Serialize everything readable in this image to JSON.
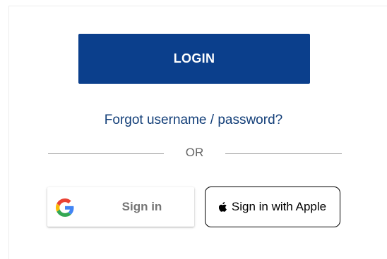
{
  "login": {
    "button_label": "LOGIN",
    "button_color": "#0b3f8c"
  },
  "forgot": {
    "link_text": "Forgot username / password?",
    "color": "#123e78"
  },
  "divider": {
    "text": "OR"
  },
  "social": {
    "google": {
      "label": "Sign in",
      "icon": "google-g-icon"
    },
    "apple": {
      "label": "Sign in with Apple",
      "icon": "apple-logo-icon"
    }
  }
}
